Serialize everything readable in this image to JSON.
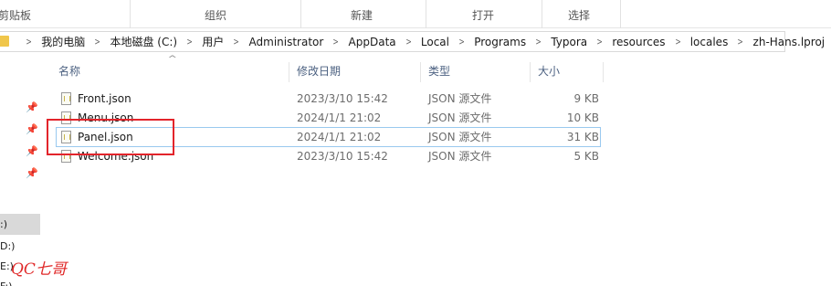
{
  "ribbon": {
    "groups": [
      "剪贴板",
      "组织",
      "新建",
      "打开",
      "选择"
    ]
  },
  "address": {
    "crumbs": [
      "我的电脑",
      "本地磁盘 (C:)",
      "用户",
      "Administrator",
      "AppData",
      "Local",
      "Programs",
      "Typora",
      "resources",
      "locales",
      "zh-Hans.lproj"
    ]
  },
  "nav": {
    "drives": [
      ":)",
      "D:)",
      "E:)",
      "F:)"
    ]
  },
  "columns": {
    "name": "名称",
    "modified": "修改日期",
    "type": "类型",
    "size": "大小"
  },
  "files": [
    {
      "name": "Front.json",
      "modified": "2023/3/10 15:42",
      "type": "JSON 源文件",
      "size": "9 KB"
    },
    {
      "name": "Menu.json",
      "modified": "2024/1/1 21:02",
      "type": "JSON 源文件",
      "size": "10 KB"
    },
    {
      "name": "Panel.json",
      "modified": "2024/1/1 21:02",
      "type": "JSON 源文件",
      "size": "31 KB"
    },
    {
      "name": "Welcome.json",
      "modified": "2023/3/10 15:42",
      "type": "JSON 源文件",
      "size": "5 KB"
    }
  ],
  "highlighted_file": "Panel.json",
  "watermark": "QC七哥",
  "colors": {
    "annotation": "#e3242b",
    "selection_border": "#99c9ef",
    "header_text": "#4d6282",
    "watermark": "#e02a2a"
  }
}
